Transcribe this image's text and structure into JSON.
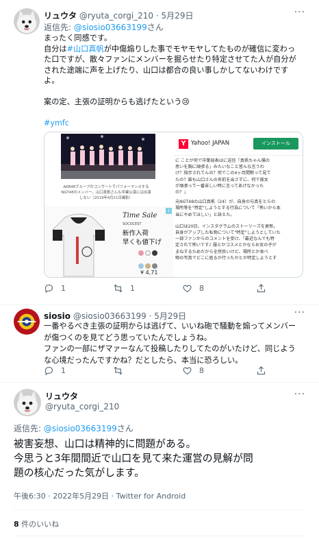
{
  "tweet1": {
    "display_name": "リュウタ",
    "handle": "@ryuta_corgi_210",
    "separator": "·",
    "date": "5月29日",
    "more_label": "···",
    "reply_prefix": "返信先:",
    "reply_handle": "@siosio03663199",
    "reply_suffix": "さん",
    "lines": {
      "l1": "まったく同感です。",
      "l2a": "自分は",
      "l2tag": "#山口真帆",
      "l2b": "が中傷煽りした事でモヤモヤしてたものが確信に変わっ",
      "l3": "た口ですが、散々ファンにメンバーを掘らせたり特定させてた人が自分が",
      "l4": "された途端に声を上げたり、山口は都合の良い事しかしてないわけです",
      "l5": "よ。",
      "l6": "案の定、主張の証明からも逃げたという😢",
      "hashtag": "#ymfc"
    },
    "media": {
      "caption1": "AKB48グループのコンサートでパフォーマンスする",
      "caption2": "NGT48のメンバー。山口真帆さんも卒業公演には出演",
      "caption3": "しない（2019年4月21日撮影）",
      "ad_brand": "Yahoo! JAPAN",
      "ad_button": "インストール",
      "article_top": [
        "に ことが何で中業局表はに送信「真帆ちゃん僕の",
        "思いを胸に頑張る」みたいなこと皆んな言うわ",
        "け？指示されてんの？何でこの4ヶ月間黙って見て",
        "たの？誰も山口さんの名前を出さずに、何で彼女",
        "が頑張って一番苦しい時に言ってあげなかった",
        "の？」"
      ],
      "article_mid": [
        "元NGT48の山口真帆（24）が、自身の与真をとらの",
        "場所等を\"特定\"しようとする行為について「怖いから本",
        "当にやめてほしい」と訴えた。"
      ],
      "article_bottom": [
        "山口は20日、インスタグラムのストーリーズを更新。",
        "自身がアップした私物について\"特定\"しようとしていた",
        "一部ファンからのコメントを受け、「最近なんでも特",
        "定されて怖いです♪ 服とかコスメとかならお女の子が",
        "まねするためだから全然良いけど、場所とか食べ",
        "物の写真でどこに居るか行ったかとか特定しようとす"
      ],
      "shirt_title": "Time Sale",
      "shirt_sub": "SOCOCEST",
      "shirt_jp1": "新作入荷",
      "shirt_jp2": "早くも値下げ",
      "shirt_price": "¥ 4,71"
    },
    "reply_count": "1",
    "retweet_count": "1",
    "like_count": "8"
  },
  "tweet2": {
    "display_name": "siosio",
    "handle": "@siosio03663199",
    "separator": "·",
    "date": "5月29日",
    "more_label": "···",
    "lines": {
      "l1": "一番やるべき主張の証明からは逃げて、いいね砲で騒動を煽ってメンバー",
      "l2": "が傷つくのを見てどう思っていたんでしょうね。",
      "l3": "ファンの一部にザマァーなんて投稿したりしてたのがいたけど、同じよう",
      "l4": "な心境だったんですかね？だとしたら、本当に恐ろしい。"
    },
    "reply_count": "1",
    "retweet_count": "",
    "like_count": "8"
  },
  "main": {
    "display_name": "リュウタ",
    "handle": "@ryuta_corgi_210",
    "more_label": "···",
    "reply_prefix": "返信先:",
    "reply_handle": "@siosio03663199",
    "reply_suffix": "さん",
    "l1": "被害妄想、山口は精神的に問題がある。",
    "l2": "今思うと3年間間近で山口を見て来た運営の見解が問",
    "l3": "題の核心だった気がします。",
    "timestamp": "午後6:30 · 2022年5月29日 · Twitter for Android",
    "likes_count": "8",
    "likes_label": "件のいいね"
  },
  "colors": {
    "accent": "#1d9bf0",
    "text": "#0f1419",
    "secondary": "#536471",
    "border": "#eff3f4"
  },
  "icons": [
    "more-icon",
    "reply-icon",
    "retweet-icon",
    "like-icon",
    "share-icon"
  ]
}
